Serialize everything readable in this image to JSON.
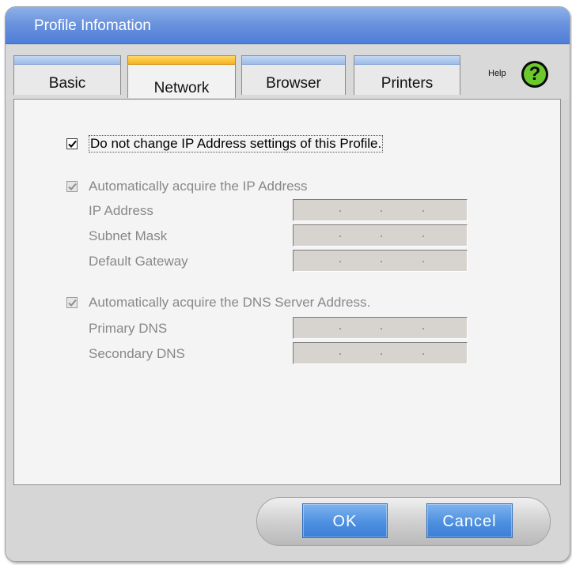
{
  "window": {
    "title": "Profile Infomation"
  },
  "tabs": [
    {
      "label": "Basic",
      "active": false
    },
    {
      "label": "Network",
      "active": true
    },
    {
      "label": "Browser",
      "active": false
    },
    {
      "label": "Printers",
      "active": false
    }
  ],
  "help": {
    "label": "Help",
    "icon": "help-question-icon"
  },
  "network": {
    "keep_ip": {
      "label": "Do not change IP Address settings of this Profile.",
      "checked": true,
      "enabled": true
    },
    "auto_ip": {
      "label": "Automatically acquire the IP Address",
      "checked": true,
      "enabled": false
    },
    "ip_address": {
      "label": "IP Address",
      "value": ". . ."
    },
    "subnet_mask": {
      "label": "Subnet Mask",
      "value": ". . ."
    },
    "default_gateway": {
      "label": "Default Gateway",
      "value": ". . ."
    },
    "auto_dns": {
      "label": "Automatically acquire the DNS Server Address.",
      "checked": true,
      "enabled": false
    },
    "primary_dns": {
      "label": "Primary DNS",
      "value": ". . ."
    },
    "secondary_dns": {
      "label": "Secondary DNS",
      "value": ". . ."
    }
  },
  "buttons": {
    "ok": "OK",
    "cancel": "Cancel"
  },
  "colors": {
    "title_bar": "#5b87db",
    "active_tab_accent": "#f5b21b",
    "button_blue": "#4d90e0"
  }
}
